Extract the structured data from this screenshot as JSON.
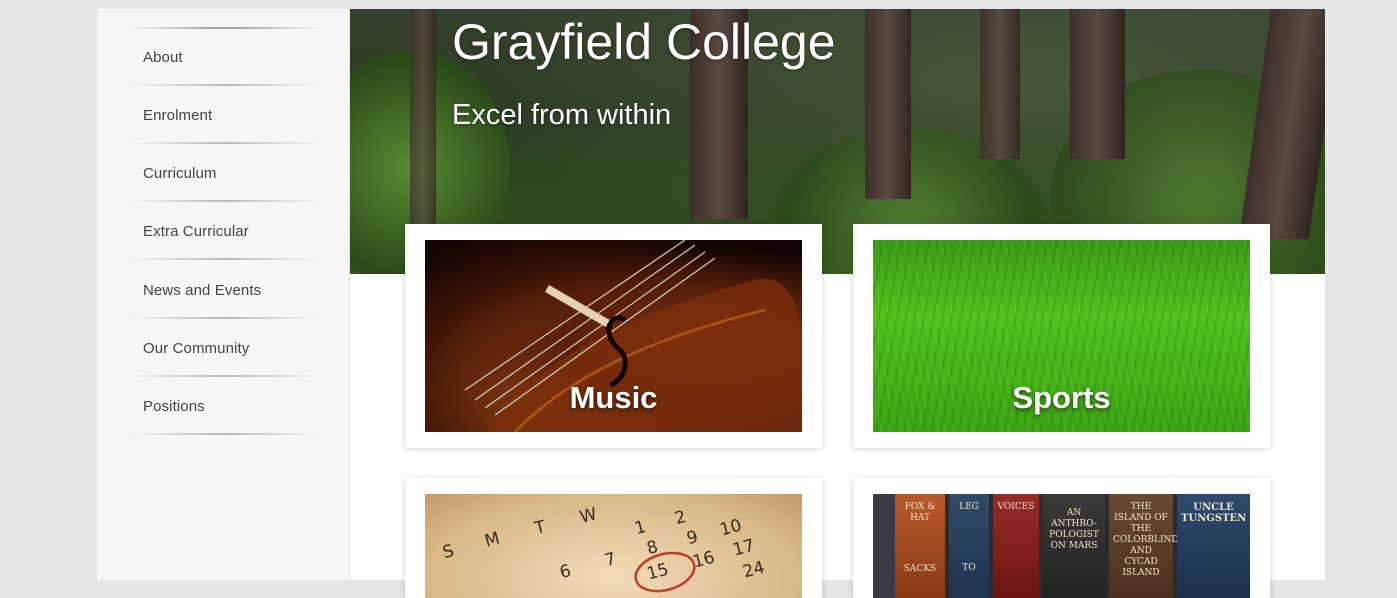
{
  "sidebar": {
    "items": [
      {
        "label": "About"
      },
      {
        "label": "Enrolment"
      },
      {
        "label": "Curriculum"
      },
      {
        "label": "Extra Curricular"
      },
      {
        "label": "News and Events"
      },
      {
        "label": "Our Community"
      },
      {
        "label": "Positions"
      }
    ]
  },
  "hero": {
    "title": "Grayfield College",
    "subtitle": "Excel from within"
  },
  "cards": [
    {
      "caption": "Music"
    },
    {
      "caption": "Sports"
    }
  ],
  "calendar_numbers": [
    "S",
    "M",
    "T",
    "W",
    "1",
    "2",
    "9",
    "10",
    "6",
    "7",
    "8",
    "15",
    "16",
    "17",
    "24"
  ],
  "book_titles": [
    "FOX & HAT",
    "SACKS",
    "LEG",
    "TO",
    "VOICES",
    "AN ANTHRO- POLOGIST ON MARS",
    "THE ISLAND OF THE COLORBLIND AND CYCAD ISLAND",
    "UNCLE TUNGSTEN"
  ]
}
